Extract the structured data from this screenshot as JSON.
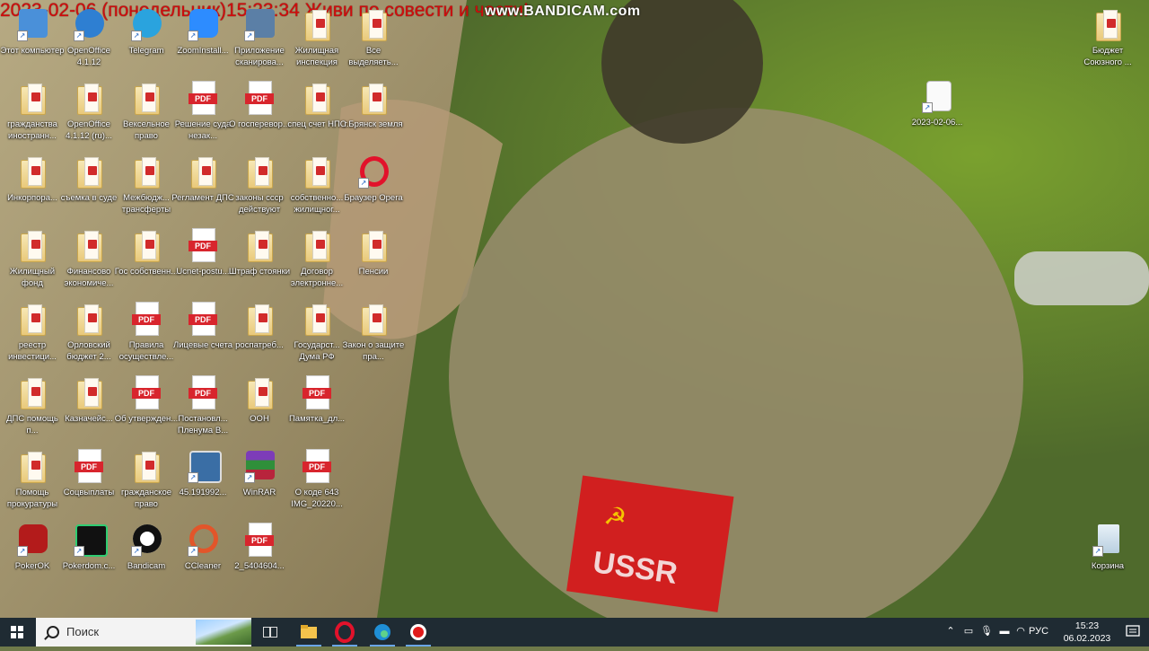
{
  "overlay": {
    "recording_text": "2023-02-06 (понедельник)15:23:34 Живи по совести и чести!",
    "watermark": "www.BANDICAM.com"
  },
  "desktop": {
    "icons": [
      {
        "label": "Этот компьютер",
        "kind": "app",
        "icon": "computer-icon"
      },
      {
        "label": "OpenOffice 4.1.12",
        "kind": "app",
        "icon": "openoffice-icon"
      },
      {
        "label": "Telegram",
        "kind": "app",
        "icon": "telegram-icon"
      },
      {
        "label": "ZoomInstall...",
        "kind": "app",
        "icon": "zoom-icon"
      },
      {
        "label": "Приложение сканирова...",
        "kind": "app",
        "icon": "scanner-icon"
      },
      {
        "label": "Жилищная инспекция",
        "kind": "folder",
        "icon": "folder-icon"
      },
      {
        "label": "Все выделяеть...",
        "kind": "folder",
        "icon": "folder-icon"
      },
      {
        "label": "гражданства иностранн...",
        "kind": "folder",
        "icon": "folder-icon"
      },
      {
        "label": "OpenOffice 4.1.12 (ru)...",
        "kind": "folder",
        "icon": "folder-icon"
      },
      {
        "label": "Вексельное право",
        "kind": "folder",
        "icon": "folder-icon"
      },
      {
        "label": "Решение суда незак...",
        "kind": "pdf",
        "icon": "pdf-icon"
      },
      {
        "label": "О госперевор...",
        "kind": "pdf",
        "icon": "pdf-icon"
      },
      {
        "label": "спец счет НПС",
        "kind": "folder",
        "icon": "folder-icon"
      },
      {
        "label": "г.Брянск земля",
        "kind": "folder",
        "icon": "folder-icon"
      },
      {
        "label": "Инкорпора...",
        "kind": "folder",
        "icon": "folder-icon"
      },
      {
        "label": "съемка в суде",
        "kind": "folder",
        "icon": "folder-icon"
      },
      {
        "label": "Межбюдж... трансферты",
        "kind": "folder",
        "icon": "folder-icon"
      },
      {
        "label": "Регламент ДПС",
        "kind": "folder",
        "icon": "folder-icon"
      },
      {
        "label": "законы ссср действуют",
        "kind": "folder",
        "icon": "folder-icon"
      },
      {
        "label": "собственно... жилищног...",
        "kind": "folder",
        "icon": "folder-icon"
      },
      {
        "label": "Браузер Opera",
        "kind": "app",
        "icon": "opera-icon"
      },
      {
        "label": "Жилищный фонд",
        "kind": "folder",
        "icon": "folder-icon"
      },
      {
        "label": "Финансово экономиче...",
        "kind": "folder",
        "icon": "folder-icon"
      },
      {
        "label": "Гос собственн...",
        "kind": "folder",
        "icon": "folder-icon"
      },
      {
        "label": "Ucnet-postu...",
        "kind": "pdf",
        "icon": "pdf-icon"
      },
      {
        "label": "Штраф стоянки",
        "kind": "folder",
        "icon": "folder-icon"
      },
      {
        "label": "Договор электронне...",
        "kind": "folder",
        "icon": "folder-icon"
      },
      {
        "label": "Пенсии",
        "kind": "folder",
        "icon": "folder-icon"
      },
      {
        "label": "реестр инвестици...",
        "kind": "folder",
        "icon": "folder-icon"
      },
      {
        "label": "Орловский бюджет 2...",
        "kind": "folder",
        "icon": "folder-icon"
      },
      {
        "label": "Правила осуществле...",
        "kind": "pdf",
        "icon": "pdf-icon"
      },
      {
        "label": "Лицевые счета",
        "kind": "pdf",
        "icon": "pdf-icon"
      },
      {
        "label": "роспатреб...",
        "kind": "folder",
        "icon": "folder-icon"
      },
      {
        "label": "Государст... Дума РФ",
        "kind": "folder",
        "icon": "folder-icon"
      },
      {
        "label": "Закон о защите пра...",
        "kind": "folder",
        "icon": "folder-icon"
      },
      {
        "label": "ДПС помощь п...",
        "kind": "folder",
        "icon": "folder-icon"
      },
      {
        "label": "Казначейс...",
        "kind": "folder",
        "icon": "folder-icon"
      },
      {
        "label": "Об утвержден...",
        "kind": "pdf",
        "icon": "pdf-icon"
      },
      {
        "label": "Постановл... Пленума В...",
        "kind": "pdf",
        "icon": "pdf-icon"
      },
      {
        "label": "ООН",
        "kind": "folder",
        "icon": "folder-icon"
      },
      {
        "label": "Памятка_дл...",
        "kind": "pdf",
        "icon": "pdf-icon"
      },
      {
        "label": "Помощь прокуратуры",
        "kind": "folder",
        "icon": "folder-icon"
      },
      {
        "label": "Соцвыплаты",
        "kind": "pdf",
        "icon": "pdf-icon"
      },
      {
        "label": "гражданское право",
        "kind": "folder",
        "icon": "folder-icon"
      },
      {
        "label": "45.191992...",
        "kind": "app",
        "icon": "remote-desktop-icon"
      },
      {
        "label": "WinRAR",
        "kind": "app",
        "icon": "winrar-icon"
      },
      {
        "label": "О коде 643 IMG_20220...",
        "kind": "pdf",
        "icon": "pdf-icon"
      },
      {
        "label": "PokerOK",
        "kind": "app",
        "icon": "pokerok-icon"
      },
      {
        "label": "Pokerdom.c...",
        "kind": "app",
        "icon": "pokerdom-icon"
      },
      {
        "label": "Bandicam",
        "kind": "app",
        "icon": "bandicam-icon"
      },
      {
        "label": "CCleaner",
        "kind": "app",
        "icon": "ccleaner-icon"
      },
      {
        "label": "2_5404604...",
        "kind": "pdf",
        "icon": "pdf-icon"
      },
      {
        "label": "Бюджет Союзного ...",
        "kind": "folder",
        "icon": "folder-icon"
      },
      {
        "label": "2023-02-06...",
        "kind": "app",
        "icon": "document-icon"
      },
      {
        "label": "Корзина",
        "kind": "app",
        "icon": "recycle-bin-icon"
      }
    ]
  },
  "taskbar": {
    "search_placeholder": "Поиск",
    "language": "РУС",
    "time": "15:23",
    "date": "06.02.2023"
  }
}
